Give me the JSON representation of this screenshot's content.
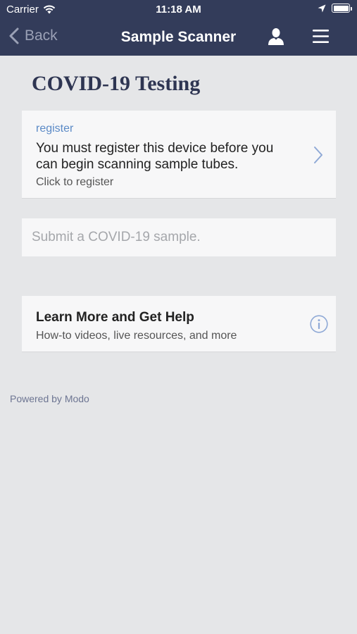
{
  "status_bar": {
    "carrier": "Carrier",
    "time": "11:18 AM"
  },
  "nav": {
    "back_label": "Back",
    "title": "Sample Scanner",
    "icons": {
      "user": "user-icon",
      "menu": "hamburger-menu-icon"
    }
  },
  "page": {
    "title": "COVID-19 Testing"
  },
  "register_card": {
    "label": "register",
    "message": "You must register this device before you can begin scanning sample tubes.",
    "subtext": "Click to register"
  },
  "sample_input": {
    "placeholder": "Submit a COVID-19 sample.",
    "value": ""
  },
  "help_card": {
    "title": "Learn More and Get Help",
    "subtitle": "How-to videos, live resources, and more"
  },
  "footer": {
    "powered_by": "Powered by Modo"
  },
  "colors": {
    "nav_background": "#333c5a",
    "page_background": "#e5e6e8",
    "accent": "#5b8ac6",
    "title": "#2e3552"
  }
}
